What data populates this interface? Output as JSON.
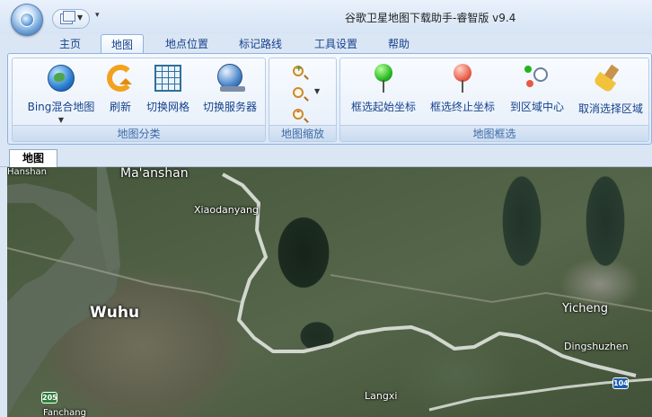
{
  "window": {
    "title": "谷歌卫星地图下载助手-睿智版 v9.4"
  },
  "ribbon_tabs": [
    {
      "label": "主页",
      "active": false
    },
    {
      "label": "地图",
      "active": true
    },
    {
      "label": "地点位置",
      "active": false
    },
    {
      "label": "标记路线",
      "active": false
    },
    {
      "label": "工具设置",
      "active": false
    },
    {
      "label": "帮助",
      "active": false
    }
  ],
  "groups": {
    "map_category": {
      "label": "地图分类",
      "buttons": [
        {
          "label": "Bing混合地图",
          "icon": "globe-icon",
          "has_dropdown": true
        },
        {
          "label": "刷新",
          "icon": "refresh-icon"
        },
        {
          "label": "切换网格",
          "icon": "grid-icon"
        },
        {
          "label": "切换服务器",
          "icon": "server-icon"
        }
      ]
    },
    "map_zoom": {
      "label": "地图缩放",
      "buttons": [
        {
          "name": "zoom-in",
          "icon": "zoom-in-icon"
        },
        {
          "name": "zoom-level",
          "icon": "zoom-icon",
          "has_dropdown": true
        },
        {
          "name": "zoom-out",
          "icon": "zoom-out-icon"
        }
      ]
    },
    "map_select": {
      "label": "地图框选",
      "buttons": [
        {
          "label": "框选起始坐标",
          "icon": "green-pin-icon"
        },
        {
          "label": "框选终止坐标",
          "icon": "red-pin-icon"
        },
        {
          "label": "到区域中心",
          "icon": "region-center-icon"
        },
        {
          "label": "取消选择区域",
          "icon": "broom-icon"
        }
      ]
    }
  },
  "document_tab": {
    "label": "地图"
  },
  "map": {
    "labels": [
      "Hanshan",
      "Ma'anshan",
      "Xiaodanyang",
      "Wuhu",
      "Yicheng",
      "Dingshuzhen",
      "Langxi",
      "Fanchang"
    ],
    "shields": [
      "205",
      "104"
    ],
    "colors": {
      "water": "#5e6a5b",
      "road": "#e9ece6",
      "highway_shield": "#2f7d3a",
      "national_shield": "#1f5fae"
    }
  }
}
